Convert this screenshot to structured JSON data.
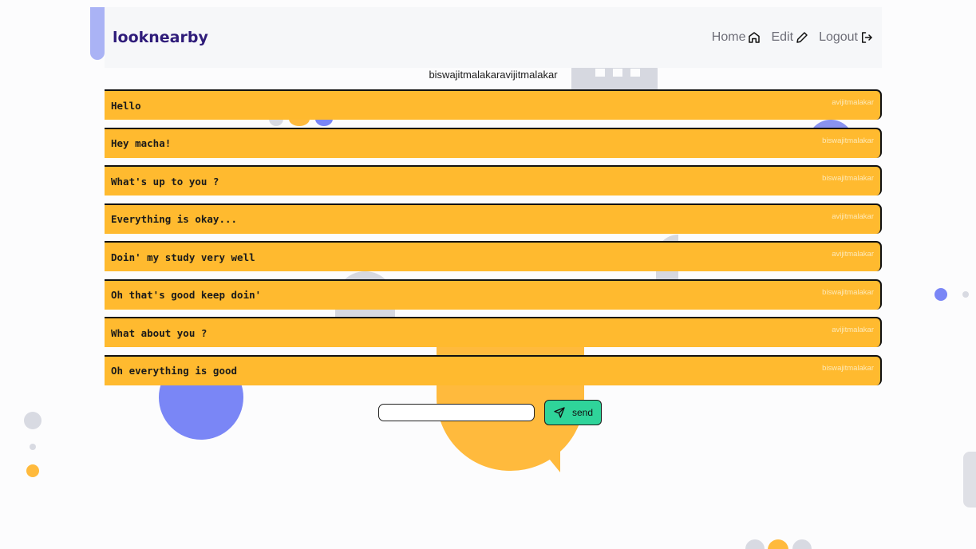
{
  "brand": {
    "name": "looknearby"
  },
  "nav": {
    "items": [
      {
        "label": "Home",
        "icon": "home-icon"
      },
      {
        "label": "Edit",
        "icon": "pencil-icon"
      },
      {
        "label": "Logout",
        "icon": "logout-icon"
      }
    ]
  },
  "chat": {
    "title": "biswajitmalakaravijitmalakar",
    "messages": [
      {
        "text": "Hello",
        "sender": "avijitmalakar"
      },
      {
        "text": "Hey macha!",
        "sender": "biswajitmalakar"
      },
      {
        "text": "What's up to you ?",
        "sender": "biswajitmalakar"
      },
      {
        "text": "Everything is okay...",
        "sender": "avijitmalakar"
      },
      {
        "text": "Doin' my study very well",
        "sender": "avijitmalakar"
      },
      {
        "text": "Oh that's good keep doin'",
        "sender": "biswajitmalakar"
      },
      {
        "text": "What about you ?",
        "sender": "avijitmalakar"
      },
      {
        "text": "Oh everything is good",
        "sender": "biswajitmalakar"
      }
    ]
  },
  "composer": {
    "input_value": "",
    "input_placeholder": "",
    "send_label": "send",
    "send_icon": "send-icon"
  },
  "colors": {
    "message_bg": "#ffba2f",
    "send_button": "#2fd49a",
    "brand": "#2f1c7a"
  }
}
